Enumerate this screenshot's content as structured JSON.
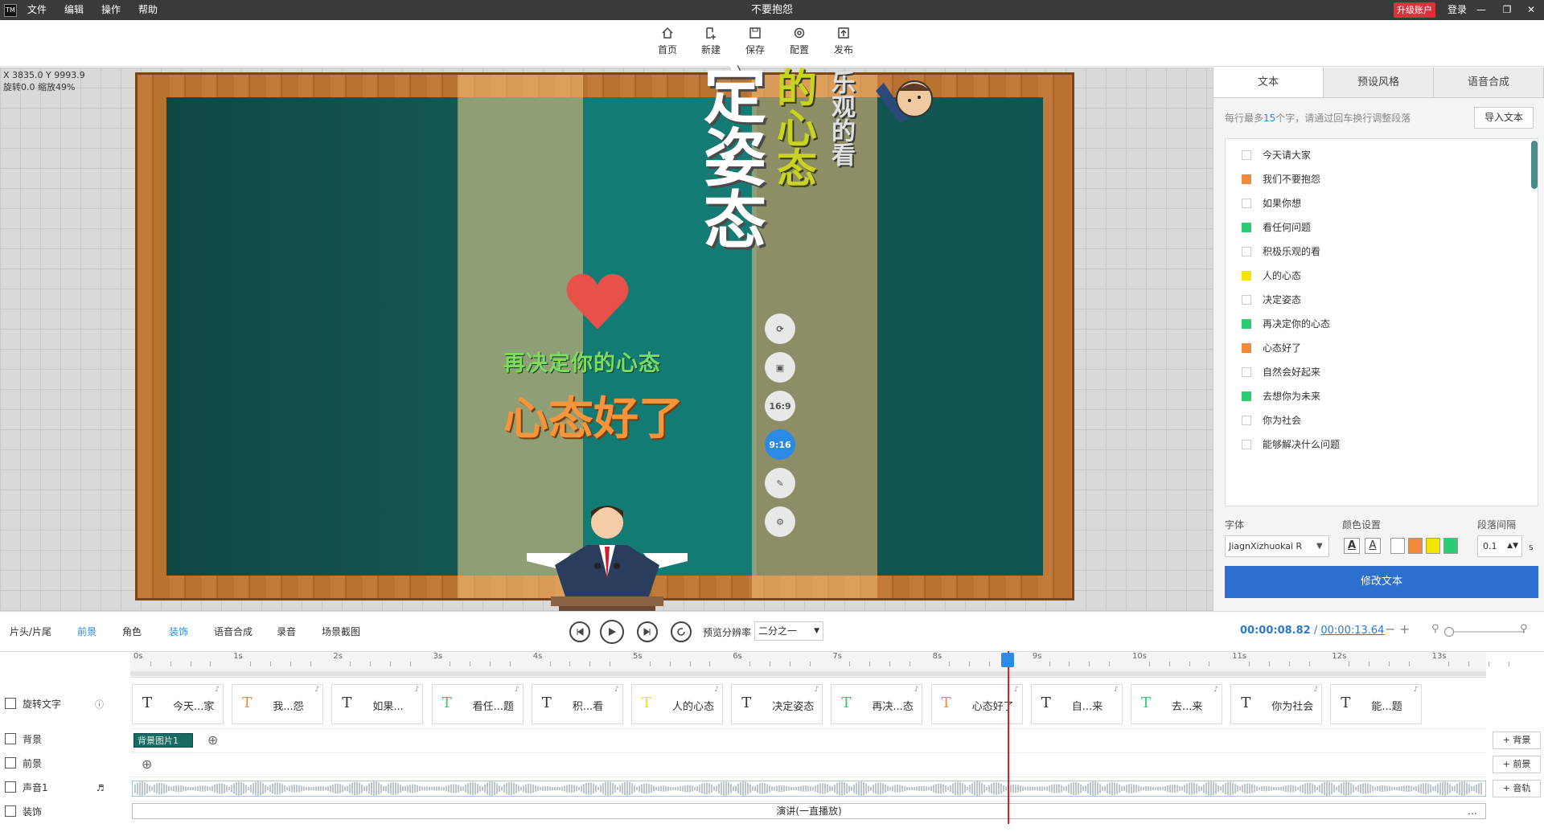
{
  "app": {
    "title": "不要抱怨",
    "menu": [
      "文件",
      "编辑",
      "操作",
      "帮助"
    ],
    "upgrade": "升级账户",
    "login": "登录",
    "logo": "TM"
  },
  "toolbar": [
    {
      "label": "首页",
      "icon": "home-icon"
    },
    {
      "label": "新建",
      "icon": "new-file-icon"
    },
    {
      "label": "保存",
      "icon": "save-icon"
    },
    {
      "label": "配置",
      "icon": "settings-icon"
    },
    {
      "label": "发布",
      "icon": "publish-icon"
    }
  ],
  "canvas": {
    "coords": "X 3835.0 Y 9993.9",
    "rotate": "旋转0.0 缩放49%",
    "vtext_left": "定姿态",
    "vtext_mid": "的心态",
    "vtext_right": "乐观的看",
    "slogan1": "再决定你的心态",
    "slogan2": "心态好了",
    "side_buttons": [
      "16:9",
      "9:16"
    ]
  },
  "right_panel": {
    "tabs": [
      "文本",
      "预设风格",
      "语音合成"
    ],
    "hint_pre": "每行最多",
    "hint_num": "15",
    "hint_post": "个字，请通过回车换行调整段落",
    "import": "导入文本",
    "lines": [
      {
        "text": "今天请大家",
        "color": ""
      },
      {
        "text": "我们不要抱怨",
        "color": "#f08a3a"
      },
      {
        "text": "如果你想",
        "color": ""
      },
      {
        "text": "看任何问题",
        "color": "#2ecc71"
      },
      {
        "text": "积极乐观的看",
        "color": ""
      },
      {
        "text": "人的心态",
        "color": "#f4e400"
      },
      {
        "text": "决定姿态",
        "color": ""
      },
      {
        "text": "再决定你的心态",
        "color": "#2ecc71"
      },
      {
        "text": "心态好了",
        "color": "#f08a3a"
      },
      {
        "text": "自然会好起来",
        "color": ""
      },
      {
        "text": "去想你为未来",
        "color": "#2ecc71"
      },
      {
        "text": "你为社会",
        "color": ""
      },
      {
        "text": "能够解决什么问题",
        "color": ""
      }
    ],
    "font_label": "字体",
    "font_value": "JiagnXizhuokai R",
    "color_label": "颜色设置",
    "spacing_label": "段落间隔",
    "spacing_value": "0.1",
    "spacing_unit": "s",
    "colors": [
      "#ffffff",
      "#f08a3a",
      "#f4e400",
      "#2ecc71"
    ],
    "modify": "修改文本"
  },
  "controls": {
    "tabs": [
      "片头/片尾",
      "前景",
      "角色",
      "装饰",
      "语音合成",
      "录音",
      "场景截图"
    ],
    "resolution_label": "预览分辨率",
    "resolution_value": "二分之一",
    "current_time": "00:00:08.82",
    "separator": "/",
    "total_time": "00:00:13.64"
  },
  "timeline": {
    "ticks": [
      "0s",
      "1s",
      "2s",
      "3s",
      "4s",
      "5s",
      "6s",
      "7s",
      "8s",
      "9s",
      "10s",
      "11s",
      "12s",
      "13s"
    ],
    "tracks": [
      "旋转文字",
      "背景",
      "前景",
      "声音1",
      "装饰"
    ],
    "clips": [
      "今天...家",
      "我...怨",
      "如果...",
      "看任...题",
      "积...看",
      "人的心态",
      "决定姿态",
      "再决...态",
      "心态好了",
      "自...来",
      "去...来",
      "你为社会",
      "能...题"
    ],
    "clip_colors": [
      "#333",
      "#f08a3a",
      "#333",
      "#2ecc71",
      "#333",
      "#f4e400",
      "#333",
      "#2ecc71",
      "#f08a3a",
      "#333",
      "#2ecc71",
      "#333",
      "#333"
    ],
    "bg_clip": "背景图片1",
    "add_bg": "+ 背景",
    "add_fg": "+ 前景",
    "add_audio": "+ 音轨",
    "deco_clip": "演讲(一直播放)",
    "deco_more": "…"
  }
}
